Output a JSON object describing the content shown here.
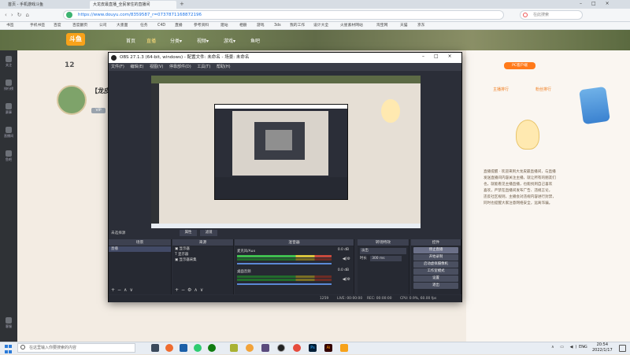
{
  "browser": {
    "tabs": [
      {
        "label": "首页 - 手机游戏斗鱼",
        "active": false
      },
      {
        "label": "大龙皮最直播_全民家住的直播间",
        "active": true
      }
    ],
    "url": "https://www.douyu.com/8359587_r=0737871168872196",
    "window_controls": [
      "–",
      "□",
      "×"
    ],
    "right_search": "在此搜索",
    "bookmarks": [
      "书签",
      "手机书签",
      "百度",
      "百度翻页",
      "公司",
      "大墨面",
      "任务",
      "C4D",
      "直播",
      "参考资料",
      "建站",
      "相册",
      "游戏",
      "3ds",
      "我的工作",
      "设计大全",
      "火星素材网站",
      "淘宝网",
      "天猫",
      "京东"
    ]
  },
  "site": {
    "logo": "斗鱼",
    "nav": [
      {
        "label": "首页",
        "active": false
      },
      {
        "label": "直播",
        "active": true
      },
      {
        "label": "分类▾",
        "active": false
      },
      {
        "label": "视频▾",
        "active": false
      },
      {
        "label": "游戏▾",
        "active": false
      },
      {
        "label": "鱼吧",
        "active": false
      }
    ],
    "rail": [
      "关注",
      "排行榜",
      "赛事",
      "直播间",
      "鱼吧",
      "客服"
    ],
    "room": {
      "level": "12",
      "title": "【龙皮",
      "badge": "VIP"
    },
    "right_panel": {
      "tabs": [
        "主播排行",
        "粉丝排行"
      ],
      "logo_text": "PC客户端"
    },
    "announcement": [
      "直播提醒 · 欢迎来到大龙皮最直播间，与直播",
      "发送直播间内容关注主播，就让所有的朋友们",
      "也，就能看见主播直播，也能找到自己喜欢",
      "喜欢，严禁在直播间发布广告、违规言论，",
      "违反社区规则，主播会对违规内容进行封禁，",
      "同时也提醒大家注意网络安全，远离诈骗。"
    ]
  },
  "obs": {
    "title": "OBS 27.1.3 (64-bit, windows) - 配置文件: 未命名 - 场景: 未命名",
    "menu": [
      "文件(F)",
      "编辑(E)",
      "视图(V)",
      "停靠部件(D)",
      "工具(T)",
      "帮助(H)"
    ],
    "no_source": "未选择源",
    "props_btn": "属性",
    "filter_btn": "滤镜",
    "docks": {
      "scenes": "场景",
      "sources": "来源",
      "mixer": "混音器",
      "transitions": "转场特效",
      "controls": "控件"
    },
    "scenes": [
      "直播"
    ],
    "sources": [
      "显示器",
      "显示器",
      "显示器采集"
    ],
    "mixer": [
      {
        "name": "麦克风/Aux",
        "db": "0.0 dB"
      },
      {
        "name": "桌面音频",
        "db": "0.0 dB"
      }
    ],
    "transition": {
      "type": "淡出",
      "duration_label": "时长",
      "duration": "300 ms"
    },
    "controls": [
      "停止直播",
      "开始录制",
      "启动虚拟摄像机",
      "工作室模式",
      "设置",
      "退出"
    ],
    "status": {
      "live": "LIVE: 00:00:00",
      "rec": "REC: 00:00:00",
      "cpu": "CPU: 0.9%, 60.00 fps",
      "dropped": "1259"
    }
  },
  "taskbar": {
    "search_placeholder": "在这里输入你要搜索的内容",
    "time": "20:54",
    "date": "2022/1/17",
    "lang": "ENG"
  }
}
